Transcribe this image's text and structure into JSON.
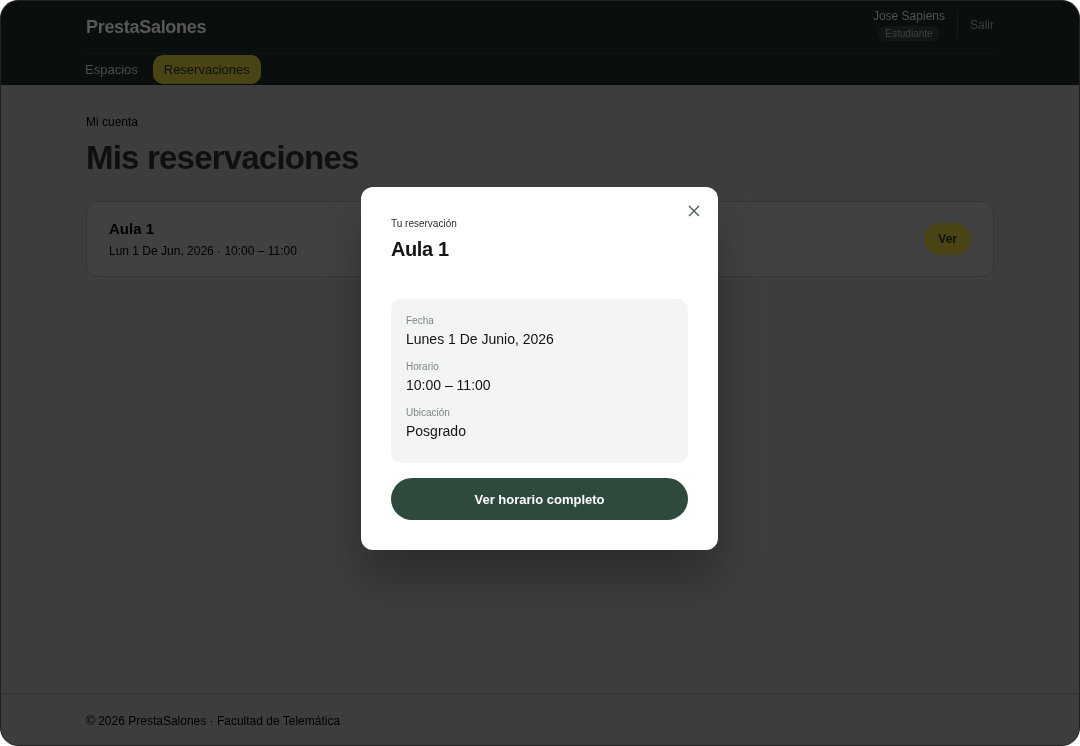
{
  "app": {
    "title": "PrestaSalones"
  },
  "nav": [
    {
      "label": "Espacios",
      "selected": false
    },
    {
      "label": "Reservaciones",
      "selected": true
    }
  ],
  "user": {
    "name": "Jose Sapiens",
    "role": "Estudiante",
    "logout": "Salir"
  },
  "breadcrumb": "Mi cuenta",
  "heading": "Mis reservaciones",
  "reservations": [
    {
      "title": "Aula 1",
      "subtitle": "Lun 1 De Jun, 2026 · 10:00 – 11:00",
      "action": "Ver"
    }
  ],
  "modal": {
    "eyebrow": "Tu reservación",
    "title": "Aula 1",
    "fields": [
      {
        "label": "Fecha",
        "value": "Lunes 1 De Junio, 2026"
      },
      {
        "label": "Horario",
        "value": "10:00 – 11:00"
      },
      {
        "label": "Ubicación",
        "value": "Posgrado"
      }
    ],
    "button": "Ver horario completo"
  },
  "footer": "© 2026 PrestaSalones · Facultad de Telemática"
}
